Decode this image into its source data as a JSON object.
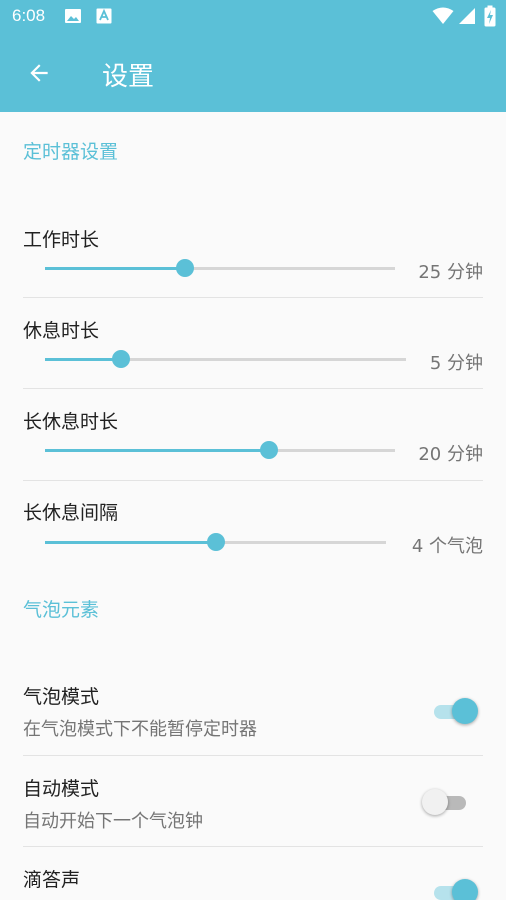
{
  "status_bar": {
    "time": "6:08",
    "icons": [
      "image-icon",
      "font-icon",
      "wifi-icon",
      "signal-icon",
      "battery-charging-icon"
    ]
  },
  "app_bar": {
    "title": "设置",
    "back_icon": "arrow-left-icon"
  },
  "sections": {
    "timer": {
      "header": "定时器设置",
      "work": {
        "title": "工作时长",
        "value_text": "25 分钟",
        "fraction": 0.4
      },
      "short_break": {
        "title": "休息时长",
        "value_text": "5 分钟",
        "fraction": 0.21
      },
      "long_break": {
        "title": "长休息时长",
        "value_text": "20 分钟",
        "fraction": 0.64
      },
      "interval": {
        "title": "长休息间隔",
        "value_text": "4 个气泡",
        "fraction": 0.5
      }
    },
    "bubble": {
      "header": "气泡元素",
      "bubble_mode": {
        "title": "气泡模式",
        "summary": "在气泡模式下不能暂停定时器",
        "on": true
      },
      "auto_mode": {
        "title": "自动模式",
        "summary": "自动开始下一个气泡钟",
        "on": false
      },
      "ticking": {
        "title": "滴答声",
        "on": true
      }
    }
  },
  "colors": {
    "accent": "#5bc0d7",
    "text": "#212121",
    "secondary_text": "#757575",
    "background": "#fafafa"
  }
}
